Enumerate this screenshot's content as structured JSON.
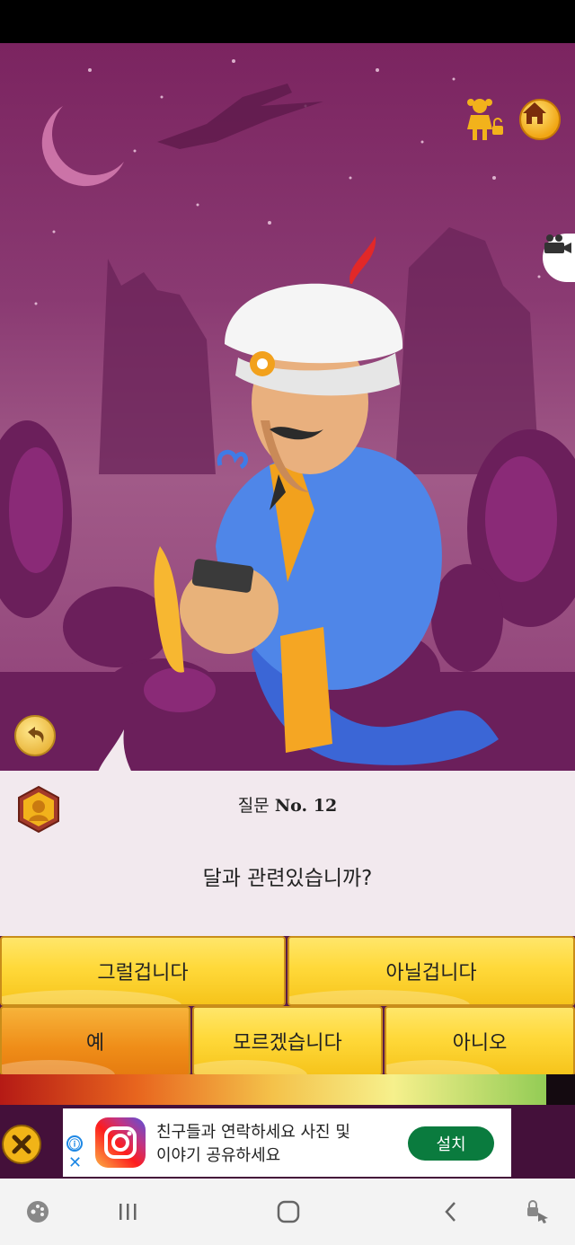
{
  "question": {
    "number_prefix": "질문",
    "number_label": "No. 12",
    "text": "달과 관련있습니까?"
  },
  "answers": {
    "probably": "그럴겁니다",
    "probably_not": "아닐겁니다",
    "yes": "예",
    "dont_know": "모르겠습니다",
    "no": "아니오",
    "selected": "예"
  },
  "progress": {
    "confidence_fraction": 0.95
  },
  "ad": {
    "text_line1": "친구들과 연락하세요 사진 및",
    "text_line2": "이야기 공유하세요",
    "install_label": "설치",
    "info_icon": "ⓘ",
    "close_glyph": "✕"
  },
  "icons": {
    "home": "home-icon",
    "child_mode": "child-lock-icon",
    "video": "video-camera-icon",
    "undo": "undo-icon",
    "badge": "profile-badge-icon",
    "close_ad": "close-x-icon"
  },
  "colors": {
    "scene_bg": "#7b2460",
    "answer_yellow": "#ffd93a",
    "answer_selected": "#ef8d18",
    "install_green": "#0a7b3e"
  }
}
